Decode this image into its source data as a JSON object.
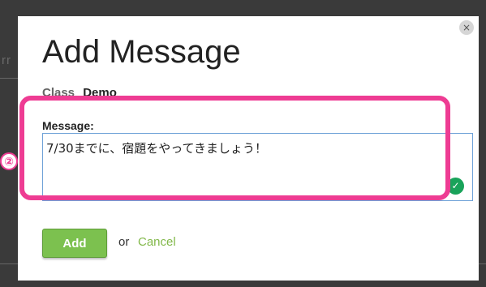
{
  "background": {
    "partial_text": "rr"
  },
  "modal": {
    "title": "Add Message",
    "close_glyph": "×",
    "class_label": "Class",
    "class_value": "Demo",
    "message_label": "Message:",
    "message_value": "7/30までに、宿題をやってきましょう！",
    "grammar_icon": "check-circle-icon",
    "add_label": "Add",
    "or_text": "or",
    "cancel_label": "Cancel"
  },
  "annotation": {
    "step_number": "②",
    "highlight_color": "#ee3c93"
  },
  "colors": {
    "add_button": "#7cc14f",
    "cancel_link": "#82b84a",
    "grammar_icon": "#19a35a",
    "textarea_border": "#6fa2d8"
  }
}
